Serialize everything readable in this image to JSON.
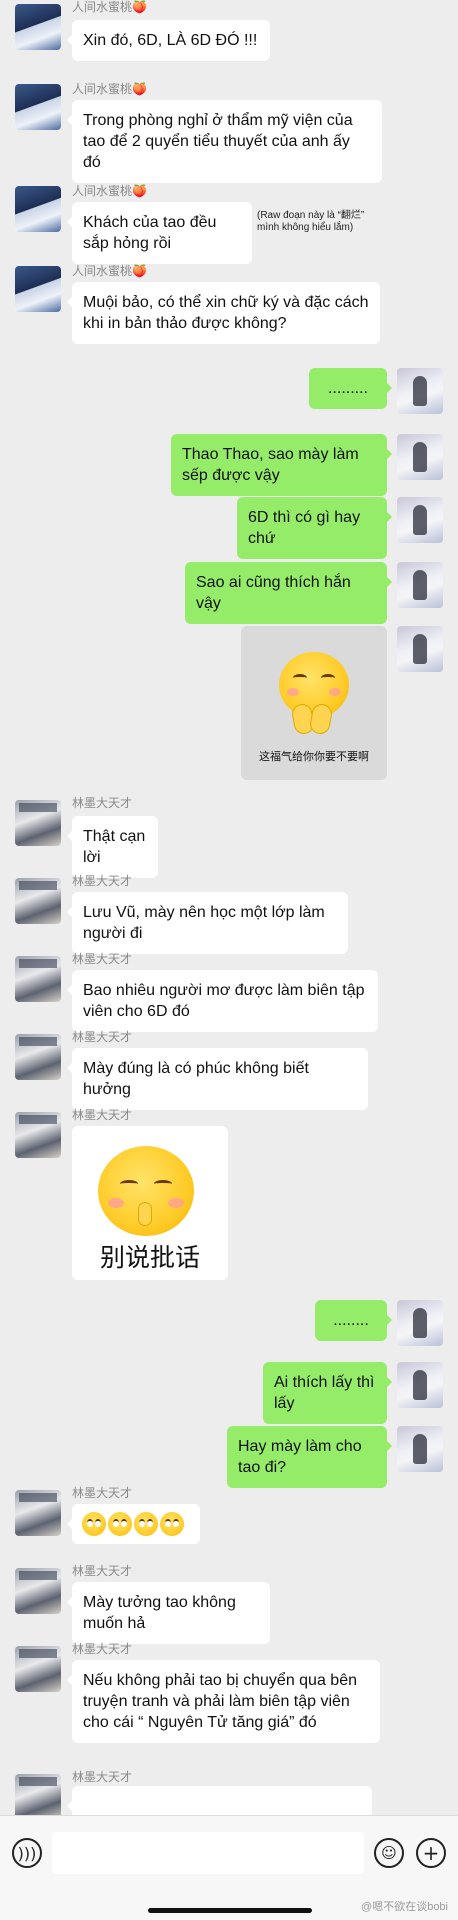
{
  "contacts": {
    "a": {
      "name": "人间水蜜桃🍑"
    },
    "c": {
      "name": "林墨大天才"
    }
  },
  "messages": [
    {
      "text": "Xin đó, 6D, LÀ 6D ĐÓ !!!"
    },
    {
      "text": "Trong phòng nghỉ ở thẩm mỹ viện của tao để 2 quyển tiểu thuyết của anh ấy đó"
    },
    {
      "text": "Khách của tao đều sắp hỏng rồi"
    },
    {
      "text": "Muội bảo, có thể xin chữ ký và đặc cách khi in bản thảo được không?"
    },
    {
      "text": "........."
    },
    {
      "text": "Thao Thao, sao mày làm sếp được vậy"
    },
    {
      "text": "6D thì có gì hay chứ"
    },
    {
      "text": "Sao ai cũng thích hắn vậy"
    },
    {
      "text": "Thật cạn lời"
    },
    {
      "text": "Lưu Vũ, mày nên học một lớp làm người đi"
    },
    {
      "text": "Bao nhiêu người mơ được làm biên tập viên cho 6D đó"
    },
    {
      "text": "Mày đúng là có phúc không biết hưởng"
    },
    {
      "text": "........"
    },
    {
      "text": "Ai thích lấy thì lấy"
    },
    {
      "text": "Hay mày làm cho tao đi?"
    },
    {
      "text": "Mày tưởng tao không muốn hả"
    },
    {
      "text": "Nếu không phải tao bị chuyển qua bên truyện tranh và phải làm biên tập viên cho cái “ Nguyên Tử tăng giá” đó"
    },
    {
      "text": ""
    }
  ],
  "note": "(Raw đoạn này là “翻烂” mình không hiểu lắm)",
  "stickers": {
    "please": {
      "caption": "这福气给你你要不要啊",
      "icon": "praying-emoji"
    },
    "nonsense": {
      "caption": "别说批话",
      "icon": "shush-emoji"
    },
    "eyeroll": {
      "icon": "eye-roll-emoji",
      "count": 4
    }
  },
  "input": {
    "voice_icon": "voice-icon",
    "emoji_icon": "emoji-icon",
    "plus_icon": "plus-icon",
    "placeholder": ""
  },
  "watermark": "@嗯不欲在谈bobi"
}
